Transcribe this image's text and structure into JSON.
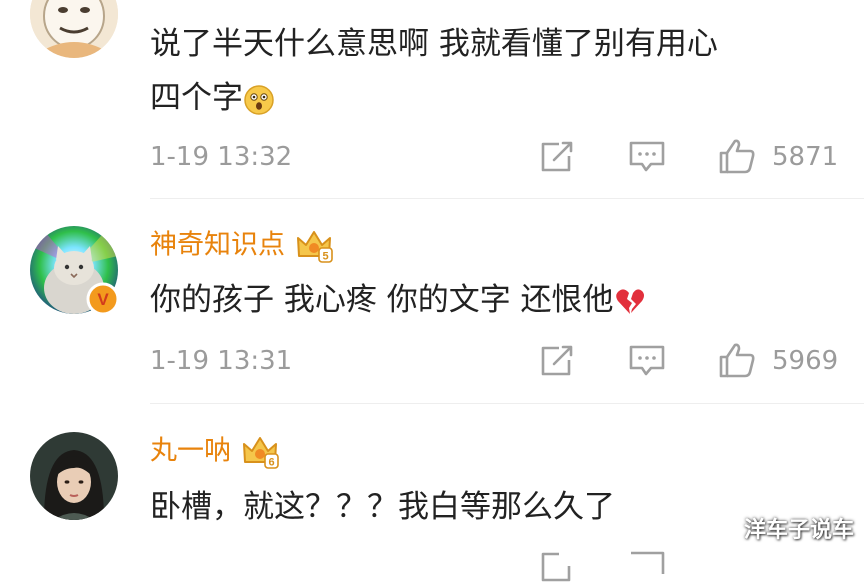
{
  "comments": [
    {
      "username": "",
      "text_line1": "说了半天什么意思啊 我就看懂了别有用心",
      "text_line2": "四个字",
      "emoji": "astonished-face-emoji",
      "time": "1-19 13:32",
      "likes": "5871"
    },
    {
      "username": "神奇知识点",
      "level_badge": "5",
      "text": "你的孩子 我心疼 你的文字 还恨他",
      "emoji": "broken-heart-emoji",
      "verified": "V",
      "time": "1-19 13:31",
      "likes": "5969"
    },
    {
      "username": "丸一呐",
      "level_badge": "6",
      "text": "卧槽，就这？？？我白等那么久了"
    }
  ],
  "watermark": "洋车子说车",
  "colors": {
    "username": "#e8830c",
    "meta_text": "#9b9b9b",
    "icon": "#a0a0a0",
    "verified_badge": "#f39a1d"
  },
  "icons": [
    "repost-icon",
    "comment-icon",
    "like-icon"
  ]
}
